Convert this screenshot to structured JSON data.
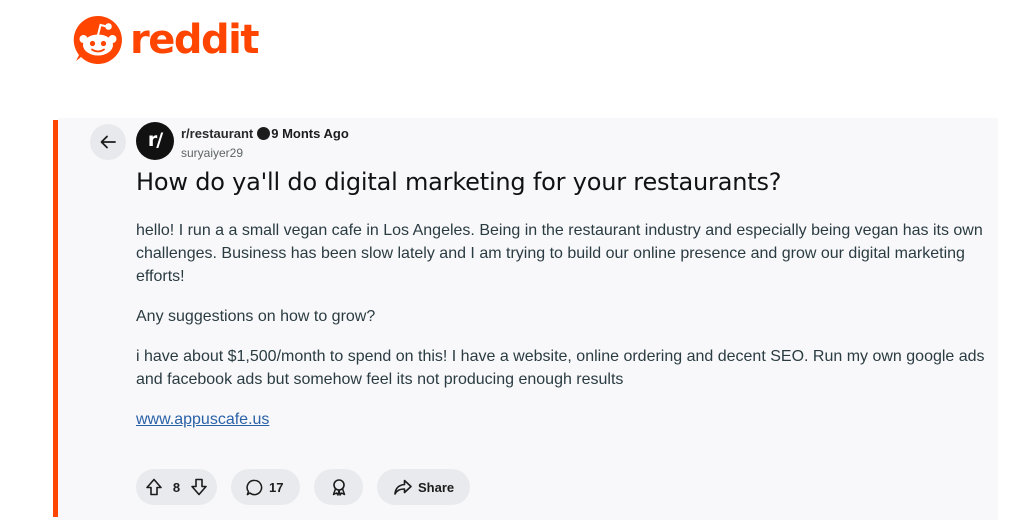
{
  "brand": {
    "name": "reddit",
    "color": "#ff4500",
    "icon": "reddit-alien-logo"
  },
  "post": {
    "subreddit": "r/restaurant",
    "subreddit_avatar_text": "r/",
    "age": "9 Monts Ago",
    "author": "suryaiyer29",
    "title": "How do ya'll do digital marketing for your restaurants?",
    "body": [
      "hello! I run a a small vegan cafe in Los Angeles. Being in the restaurant industry and especially being vegan has its own challenges. Business has been slow lately and I am trying to build our online presence and grow our digital marketing efforts!",
      "Any suggestions on how to grow?",
      "i have about $1,500/month to spend on this! I have a website, online ordering and decent SEO. Run my own google ads and facebook ads but somehow feel its not producing enough results"
    ],
    "link_text": "www.appuscafe.us"
  },
  "actions": {
    "upvote_icon": "arrow-up-icon",
    "votes": "8",
    "downvote_icon": "arrow-down-icon",
    "comment_icon": "comment-bubble-icon",
    "comments": "17",
    "award_icon": "award-ribbon-icon",
    "share_icon": "share-arrow-icon",
    "share_label": "Share"
  },
  "colors": {
    "accent_bar": "#ff4500",
    "card_background": "#f8f8fa",
    "pill_background": "#e8eaed",
    "link": "#2a62a8"
  }
}
